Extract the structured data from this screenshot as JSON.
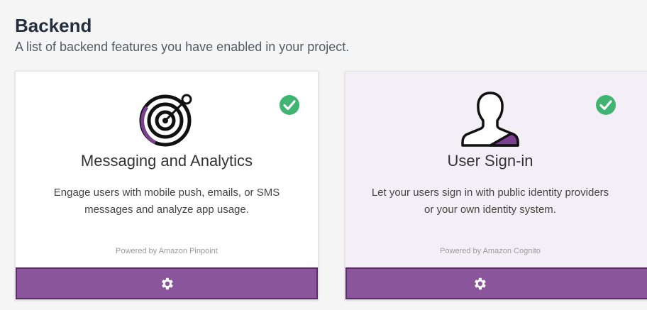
{
  "section": {
    "title": "Backend",
    "subtitle": "A list of backend features you have enabled in your project."
  },
  "colors": {
    "accent": "#8b559b",
    "accent_dark": "#5b2e6a",
    "check": "#3fb571",
    "card_alt_bg": "#f4eff6"
  },
  "cards": [
    {
      "title": "Messaging and Analytics",
      "description_line1": "Engage users with mobile push, emails, or SMS",
      "description_line2": "messages and analyze app usage.",
      "powered_by": "Powered by Amazon Pinpoint",
      "icon": "target-icon",
      "enabled": true,
      "settings_icon": "gear-icon"
    },
    {
      "title": "User Sign-in",
      "description_line1": "Let your users sign in with public identity providers",
      "description_line2": "or your own identity system.",
      "powered_by": "Powered by Amazon Cognito",
      "icon": "user-silhouette-icon",
      "enabled": true,
      "settings_icon": "gear-icon"
    }
  ]
}
